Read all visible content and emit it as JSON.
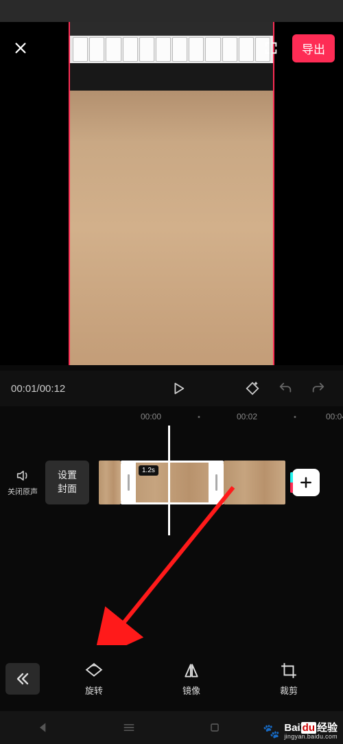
{
  "header": {
    "export_label": "导出"
  },
  "playback": {
    "current_time": "00:01",
    "total_time": "00:12"
  },
  "ruler": {
    "marks": [
      "00:00",
      "00:02",
      "00:04"
    ]
  },
  "timeline": {
    "mute_label": "关闭原声",
    "cover_line1": "设置",
    "cover_line2": "封面",
    "selected_clip_duration": "1.2s"
  },
  "tools": {
    "rotate": "旋转",
    "mirror": "镜像",
    "crop": "裁剪"
  },
  "watermark": {
    "brand_prefix": "Bai",
    "brand_mid": "du",
    "brand_suffix": "经验",
    "url": "jingyan.baidu.com"
  }
}
